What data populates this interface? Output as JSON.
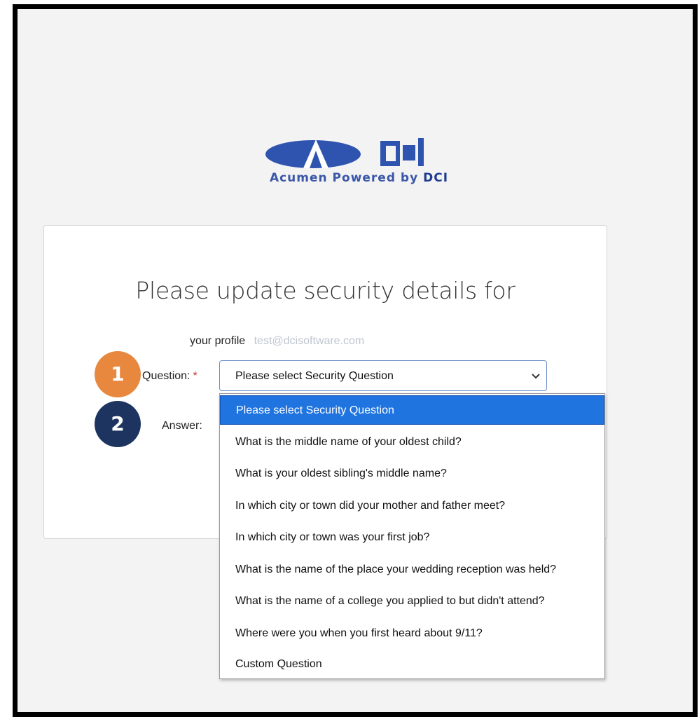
{
  "brand": {
    "tagline_prefix": "Acumen Powered by",
    "tagline_suffix": "DCI",
    "colors": {
      "primary_blue": "#3a57a8",
      "dark_blue": "#1e3b8f"
    }
  },
  "card": {
    "heading": "Please update security details for",
    "profile_label": "your profile",
    "profile_email": "test@dcisoftware.com",
    "question_label": "Question:",
    "required_mark": "*",
    "answer_label": "Answer:",
    "select_value": "Please select Security Question"
  },
  "badges": [
    {
      "number": "1",
      "color": "#e8883f"
    },
    {
      "number": "2",
      "color": "#1c345f"
    }
  ],
  "dropdown": {
    "selected_index": 0,
    "options": [
      "Please select Security Question",
      "What is the middle name of your oldest child?",
      "What is your oldest sibling's middle name?",
      "In which city or town did your mother and father meet?",
      "In which city or town was your first job?",
      "What is the name of the place your wedding reception was held?",
      "What is the name of a college you applied to but didn't attend?",
      "Where were you when you first heard about 9/11?",
      "Custom Question"
    ]
  }
}
